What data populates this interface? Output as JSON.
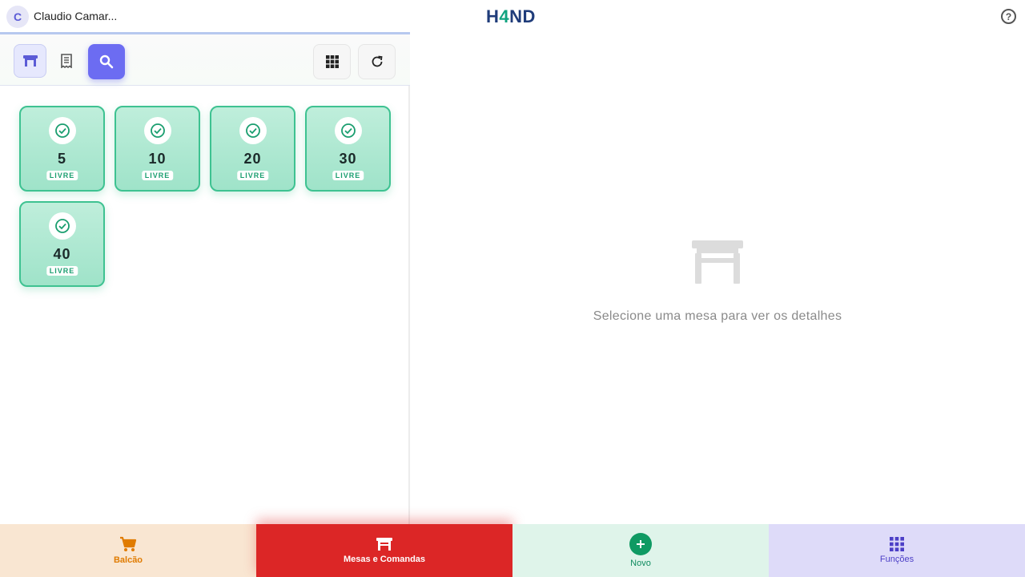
{
  "header": {
    "avatar_letter": "C",
    "username": "Claudio Camar...",
    "logo_prefix": "H",
    "logo_four": "4",
    "logo_suffix": "ND",
    "help_label": "?"
  },
  "toolbar": {
    "buttons": [
      "mesas",
      "comandas",
      "search",
      "grid-view",
      "refresh"
    ],
    "active": "mesas"
  },
  "tables": [
    {
      "number": "5",
      "status": "LIVRE"
    },
    {
      "number": "10",
      "status": "LIVRE"
    },
    {
      "number": "20",
      "status": "LIVRE"
    },
    {
      "number": "30",
      "status": "LIVRE"
    },
    {
      "number": "40",
      "status": "LIVRE"
    }
  ],
  "detail": {
    "empty_message": "Selecione uma mesa para ver os detalhes"
  },
  "bottom_nav": {
    "balcao": "Balcão",
    "mesas": "Mesas e Comandas",
    "novo": "Novo",
    "funcoes": "Funções",
    "active": "mesas"
  },
  "colors": {
    "accent": "#6c6cf2",
    "free_table": "#3ec291",
    "active_nav": "#dc2626",
    "brand": "#1f3c7a",
    "brand_accent": "#10a37f"
  }
}
